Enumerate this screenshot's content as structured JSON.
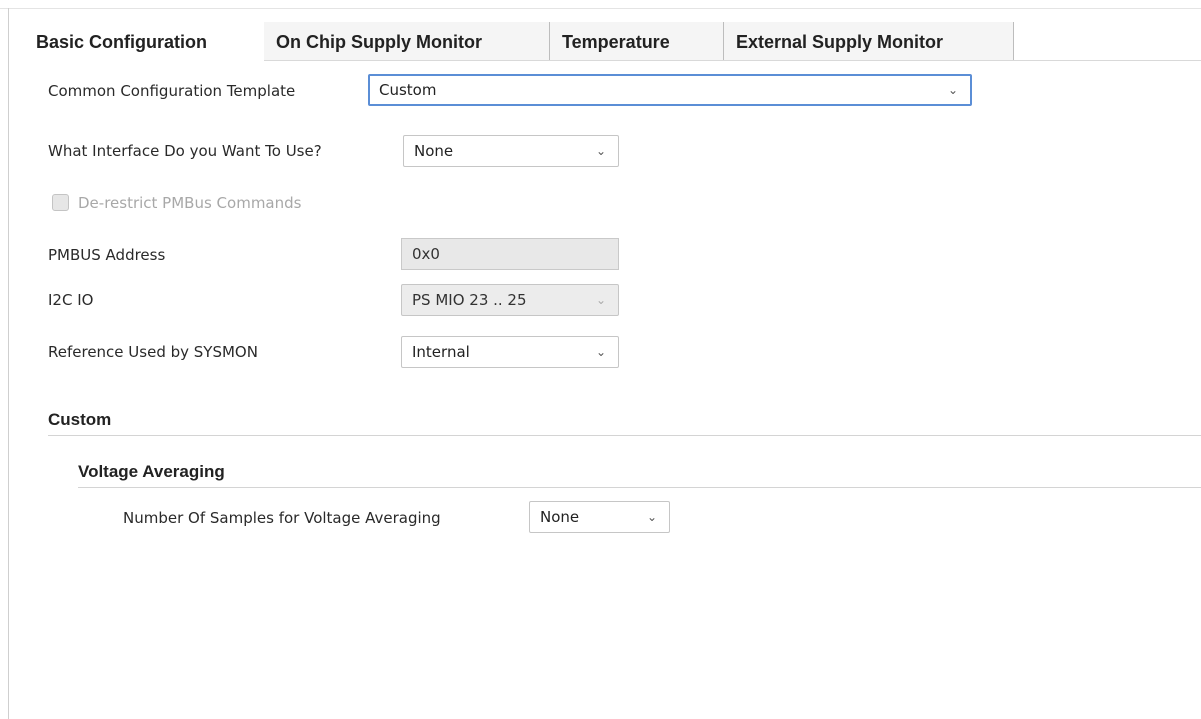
{
  "tabs": [
    {
      "label": "Basic Configuration",
      "active": true
    },
    {
      "label": "On Chip Supply Monitor",
      "active": false
    },
    {
      "label": "Temperature",
      "active": false
    },
    {
      "label": "External Supply Monitor",
      "active": false
    }
  ],
  "form": {
    "template": {
      "label": "Common Configuration Template",
      "value": "Custom"
    },
    "interface": {
      "label": "What Interface Do you Want To Use?",
      "value": "None"
    },
    "derestrict": {
      "label": "De-restrict PMBus Commands",
      "checked": false,
      "enabled": false
    },
    "pmbus_address": {
      "label": "PMBUS Address",
      "value": "0x0"
    },
    "i2c_io": {
      "label": "I2C IO",
      "value": "PS MIO 23 .. 25"
    },
    "reference": {
      "label": "Reference Used by SYSMON",
      "value": "Internal"
    }
  },
  "custom_section": {
    "title": "Custom",
    "voltage_averaging": {
      "title": "Voltage Averaging",
      "samples": {
        "label": "Number Of Samples for Voltage Averaging",
        "value": "None"
      }
    }
  },
  "icons": {
    "dropdown": "chevron-down-icon"
  },
  "colors": {
    "focus_border": "#5b8ed6",
    "disabled_text": "#a8a8a8"
  }
}
